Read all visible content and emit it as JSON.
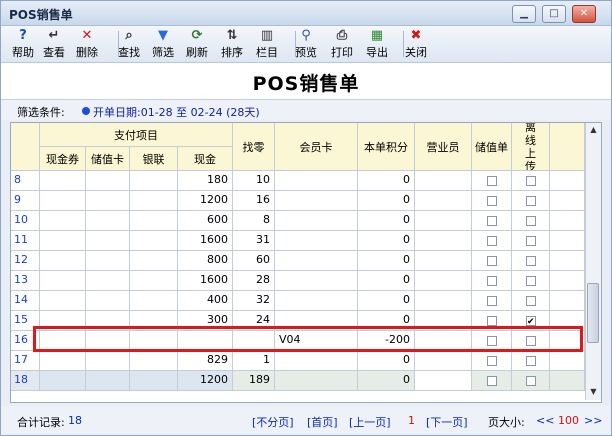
{
  "window": {
    "title": "POS销售单"
  },
  "toolbar": {
    "items": [
      {
        "label": "帮助",
        "icon": "help-icon",
        "glyph": "?"
      },
      {
        "label": "查看",
        "icon": "view-icon",
        "glyph": "↵"
      },
      {
        "label": "删除",
        "icon": "delete-icon",
        "glyph": "✕"
      },
      {
        "label": "查找",
        "icon": "find-icon",
        "glyph": "⌕"
      },
      {
        "label": "筛选",
        "icon": "filter-icon",
        "glyph": "▼"
      },
      {
        "label": "刷新",
        "icon": "refresh-icon",
        "glyph": "⟳"
      },
      {
        "label": "排序",
        "icon": "sort-icon",
        "glyph": "⇅"
      },
      {
        "label": "栏目",
        "icon": "columns-icon",
        "glyph": "▥"
      },
      {
        "label": "预览",
        "icon": "preview-icon",
        "glyph": "⚲"
      },
      {
        "label": "打印",
        "icon": "print-icon",
        "glyph": "⎙"
      },
      {
        "label": "导出",
        "icon": "export-icon",
        "glyph": "▦"
      },
      {
        "label": "关闭",
        "icon": "close-icon",
        "glyph": "✖"
      }
    ]
  },
  "page": {
    "title": "POS销售单"
  },
  "filter": {
    "label": "筛选条件:",
    "value": "开单日期:01-28 至 02-24 (28天)"
  },
  "grid": {
    "group_header": "支付项目",
    "columns": {
      "cash_coupon": "现金券",
      "stored_card": "储值卡",
      "union_pay": "银联",
      "cash": "现金",
      "change": "找零",
      "member_card": "会员卡",
      "points": "本单积分",
      "salesperson": "营业员",
      "stored_bill": "储值单",
      "offline_upload": "离线上传"
    },
    "rows": [
      {
        "no": "8",
        "cash": "180",
        "change": "10",
        "member": "",
        "points": "0",
        "stored_bill": false,
        "offline": false,
        "current": false
      },
      {
        "no": "9",
        "cash": "1200",
        "change": "16",
        "member": "",
        "points": "0",
        "stored_bill": false,
        "offline": false,
        "current": false
      },
      {
        "no": "10",
        "cash": "600",
        "change": "8",
        "member": "",
        "points": "0",
        "stored_bill": false,
        "offline": false,
        "current": false
      },
      {
        "no": "11",
        "cash": "1600",
        "change": "31",
        "member": "",
        "points": "0",
        "stored_bill": false,
        "offline": false,
        "current": false
      },
      {
        "no": "12",
        "cash": "800",
        "change": "60",
        "member": "",
        "points": "0",
        "stored_bill": false,
        "offline": false,
        "current": false
      },
      {
        "no": "13",
        "cash": "1600",
        "change": "28",
        "member": "",
        "points": "0",
        "stored_bill": false,
        "offline": false,
        "current": false
      },
      {
        "no": "14",
        "cash": "400",
        "change": "32",
        "member": "",
        "points": "0",
        "stored_bill": false,
        "offline": false,
        "current": false
      },
      {
        "no": "15",
        "cash": "300",
        "change": "24",
        "member": "",
        "points": "0",
        "stored_bill": false,
        "offline": true,
        "current": false
      },
      {
        "no": "16",
        "cash": "",
        "change": "",
        "member": "V04",
        "points": "-200",
        "stored_bill": false,
        "offline": false,
        "current": false
      },
      {
        "no": "17",
        "cash": "829",
        "change": "1",
        "member": "",
        "points": "0",
        "stored_bill": false,
        "offline": false,
        "current": false
      },
      {
        "no": "18",
        "cash": "1200",
        "change": "189",
        "member": "",
        "points": "0",
        "stored_bill": false,
        "offline": false,
        "current": true
      }
    ]
  },
  "status": {
    "total_label": "合计记录:",
    "total_value": "18",
    "no_paging": "[不分页]",
    "first": "[首页]",
    "prev": "[上一页]",
    "page_no": "1",
    "next": "[下一页]",
    "page_size_label": "页大小:",
    "size_prev": "<<",
    "page_size": "100",
    "size_next": ">>"
  },
  "colors": {
    "highlight": "#e01818",
    "header_bg": "#fbf7d4",
    "row_number": "#1a3fd6"
  }
}
